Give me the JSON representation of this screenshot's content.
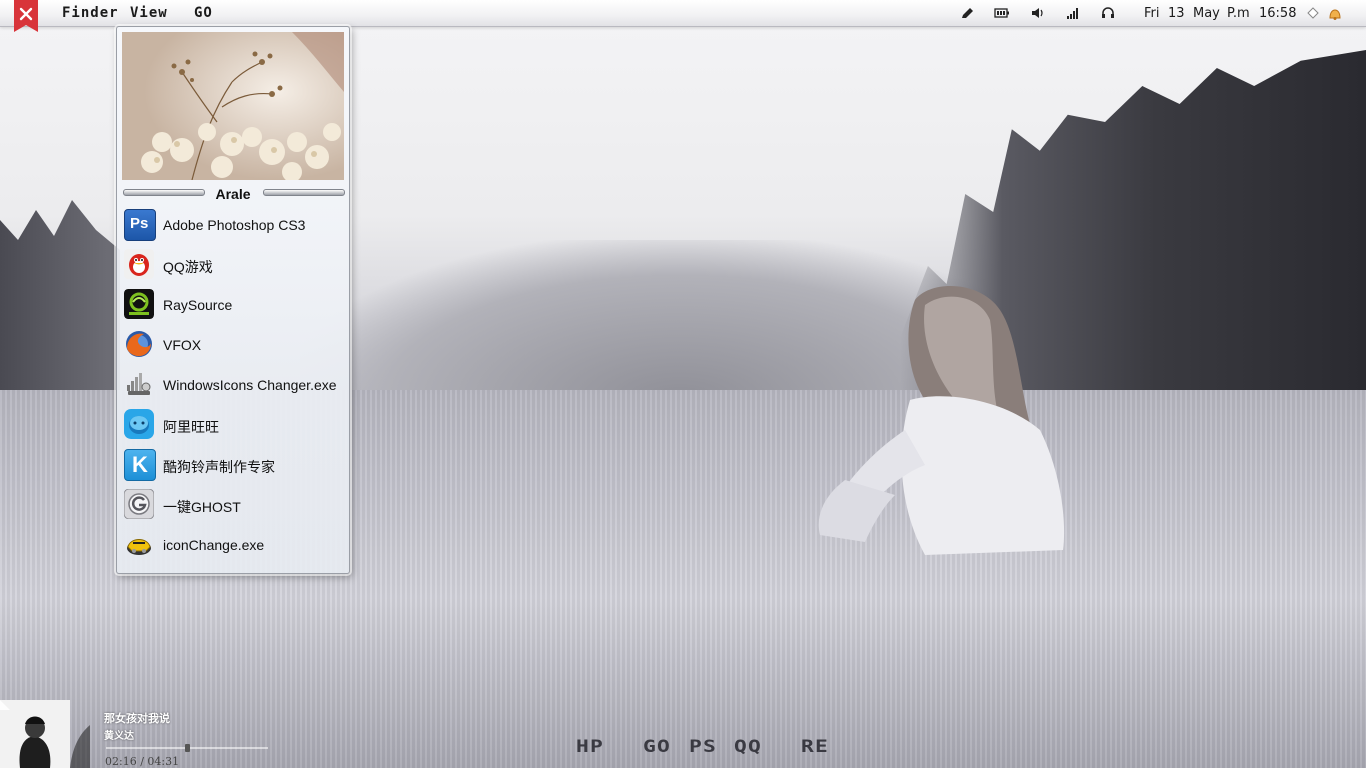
{
  "menubar": {
    "menus": [
      "Finder",
      "View",
      "GO"
    ],
    "clock": {
      "day": "Fri",
      "date": "13",
      "month": "May",
      "ampm": "P.m",
      "time": "16:58"
    },
    "tray_icons": [
      "pen-icon",
      "battery-icon",
      "volume-icon",
      "signal-icon",
      "headphones-icon",
      "diamond-icon",
      "notification-icon"
    ]
  },
  "launcher": {
    "title": "Arale",
    "apps": [
      {
        "label": "Adobe Photoshop CS3",
        "icon": "photoshop-icon",
        "icon_text": "Ps"
      },
      {
        "label": "QQ游戏",
        "icon": "qq-games-icon",
        "icon_text": ""
      },
      {
        "label": "RaySource",
        "icon": "raysource-icon",
        "icon_text": ""
      },
      {
        "label": "VFOX",
        "icon": "vfox-icon",
        "icon_text": ""
      },
      {
        "label": "WindowsIcons Changer.exe",
        "icon": "icons-changer-icon",
        "icon_text": ""
      },
      {
        "label": "阿里旺旺",
        "icon": "aliwangwang-icon",
        "icon_text": ""
      },
      {
        "label": "酷狗铃声制作专家",
        "icon": "kugou-ringtone-icon",
        "icon_text": "K"
      },
      {
        "label": "一键GHOST",
        "icon": "ghost-icon",
        "icon_text": ""
      },
      {
        "label": "iconChange.exe",
        "icon": "iconchange-icon",
        "icon_text": ""
      }
    ]
  },
  "dock": {
    "items": [
      "HP",
      "GO",
      "PS",
      "QQ",
      "RE"
    ]
  },
  "player": {
    "song": "那女孩对我说",
    "artist": "黄义达",
    "time": "02:16 / 04:31",
    "progress": 0.5
  },
  "colors": {
    "close_tab": "#d8343a",
    "ps_blue": "#1d56a8",
    "qq_red": "#d9251c",
    "raysource_green": "#7dc11f",
    "vfox_orange": "#e9681b",
    "wangwang_blue": "#2aa6e8",
    "kugou_blue": "#1d8fd6"
  }
}
